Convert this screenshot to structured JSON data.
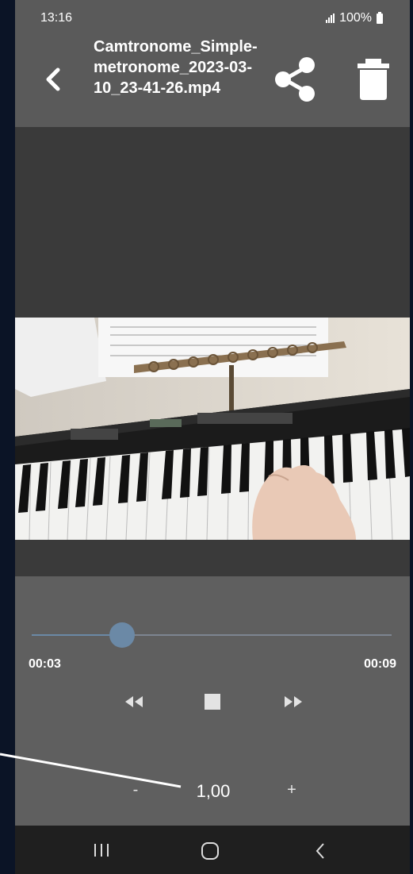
{
  "status_bar": {
    "time": "13:16",
    "battery": "100%"
  },
  "app_bar": {
    "title": "Camtronome_Simple-metronome_2023-03-10_23-41-26.mp4",
    "back_icon": "chevron-left-icon",
    "share_icon": "share-icon",
    "delete_icon": "trash-icon"
  },
  "player": {
    "current_time": "00:03",
    "total_time": "00:09",
    "progress": 0.25,
    "rewind_icon": "rewind-icon",
    "stop_icon": "stop-icon",
    "forward_icon": "fast-forward-icon"
  },
  "speed": {
    "minus_label": "-",
    "value": "1,00",
    "plus_label": "+"
  },
  "nav_bar": {
    "recents_icon": "recents-icon",
    "home_icon": "home-icon",
    "back_icon": "back-icon"
  },
  "colors": {
    "accent": "#6b89a6",
    "appbar": "#5a5a5a",
    "background": "#3a3a3a",
    "controls": "#5f5f5f"
  }
}
